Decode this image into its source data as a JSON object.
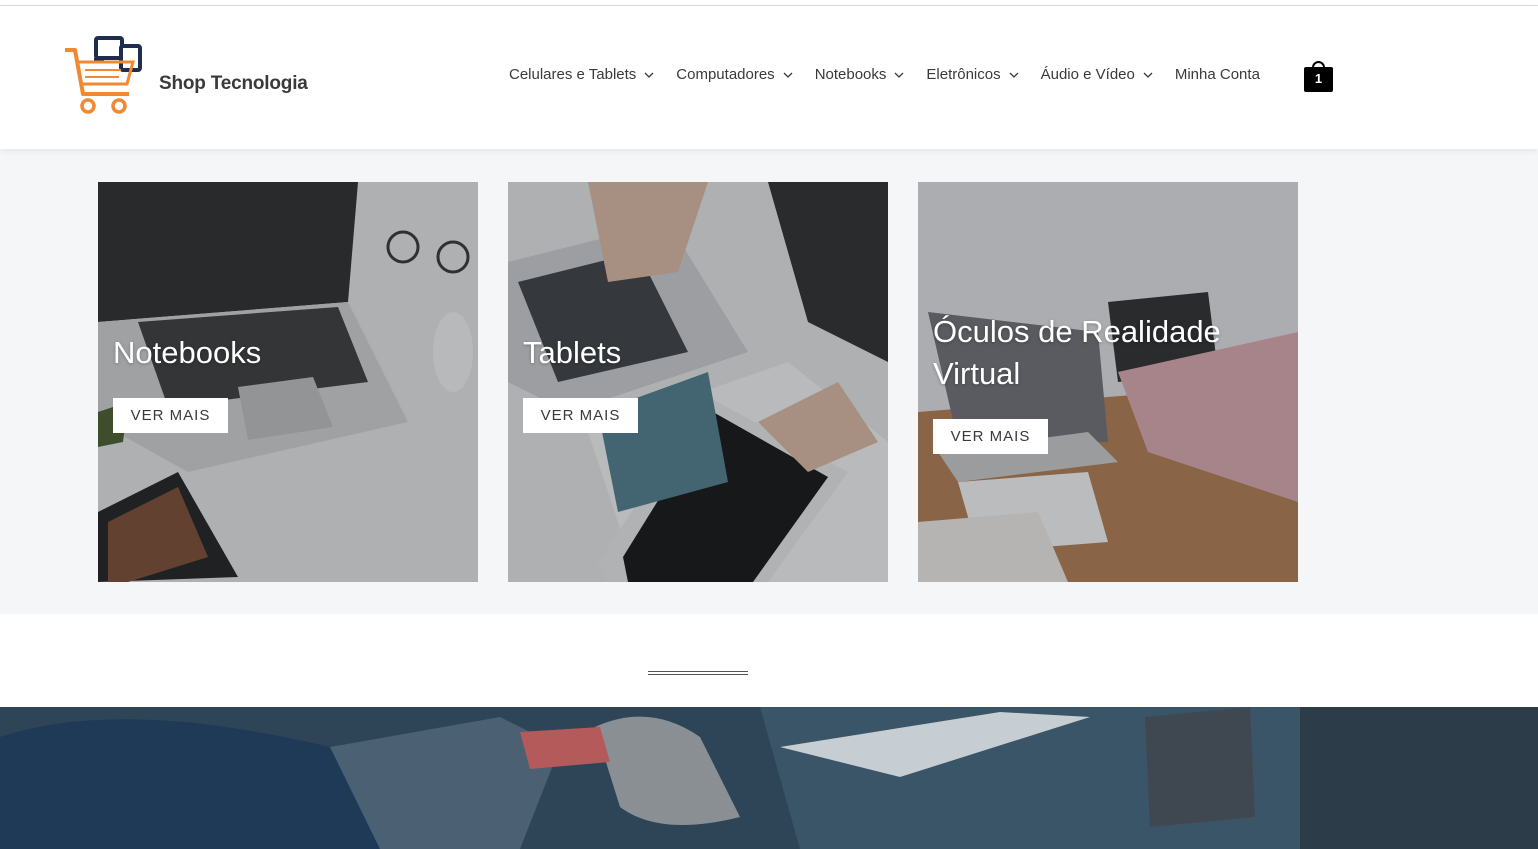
{
  "site": {
    "title": "Shop Tecnologia"
  },
  "nav": {
    "items": [
      {
        "label": "Celulares e Tablets",
        "has_dropdown": true
      },
      {
        "label": "Computadores",
        "has_dropdown": true
      },
      {
        "label": "Notebooks",
        "has_dropdown": true
      },
      {
        "label": "Eletrônicos",
        "has_dropdown": true
      },
      {
        "label": "Áudio e Vídeo",
        "has_dropdown": true
      },
      {
        "label": "Minha Conta",
        "has_dropdown": false
      }
    ]
  },
  "cart": {
    "count": "1",
    "icon": "shopping-bag-icon"
  },
  "categories": [
    {
      "title": "Notebooks",
      "button": "VER MAIS"
    },
    {
      "title": "Tablets",
      "button": "VER MAIS"
    },
    {
      "title_line1": "Óculos de Realidade",
      "title_line2": "Virtual",
      "button": "VER MAIS"
    }
  ],
  "colors": {
    "brand_orange": "#f0892f",
    "brand_navy": "#1f2d4e",
    "text": "#3a3a3a",
    "band": "#f4f6f8"
  }
}
